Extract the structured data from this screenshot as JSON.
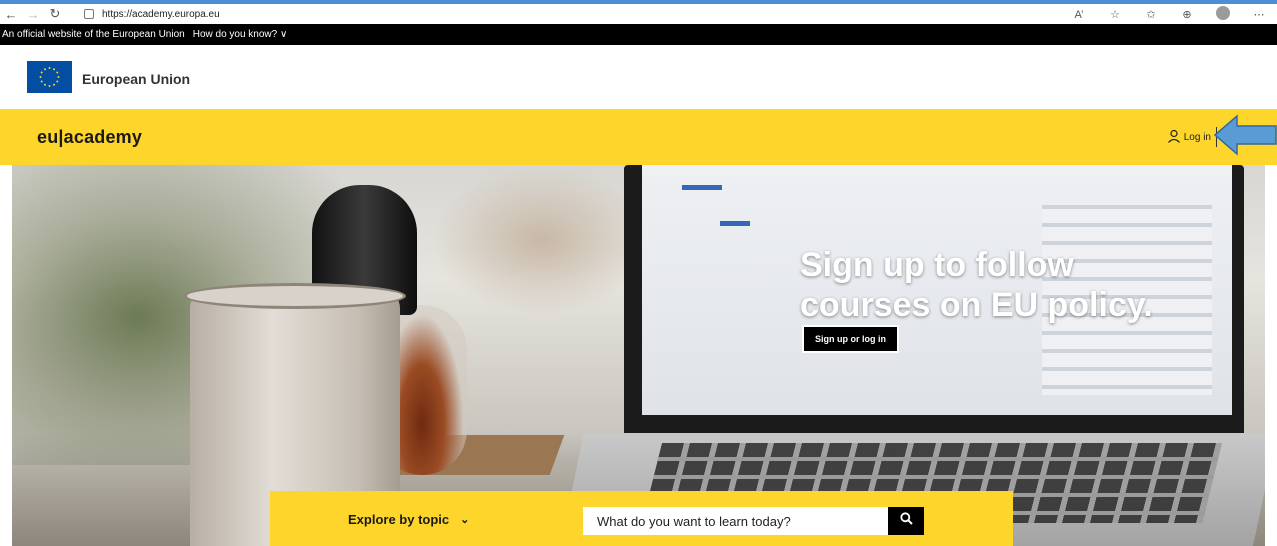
{
  "browser": {
    "url": "https://academy.europa.eu",
    "back_icon": "arrow-left-icon",
    "forward_icon": "arrow-right-icon",
    "refresh_icon": "refresh-icon",
    "tools": [
      "read-aloud-icon",
      "favorites-icon",
      "collections-icon",
      "extensions-icon",
      "profile-icon",
      "more-icon"
    ]
  },
  "official_banner": {
    "text": "An official website of the European Union",
    "how_label": "How do you know? ∨"
  },
  "eu_header": {
    "name": "European Union"
  },
  "site": {
    "logo": "eu|academy",
    "login_label": "Log in",
    "brand_color": "#fed52b"
  },
  "hero": {
    "headline_line1": "Sign up to follow",
    "headline_line2": "courses on EU policy.",
    "cta_label": "Sign up or log in"
  },
  "explore": {
    "topic_label": "Explore by topic",
    "topic_chevron": "⌄",
    "search_placeholder": "What do you want to learn today?"
  }
}
